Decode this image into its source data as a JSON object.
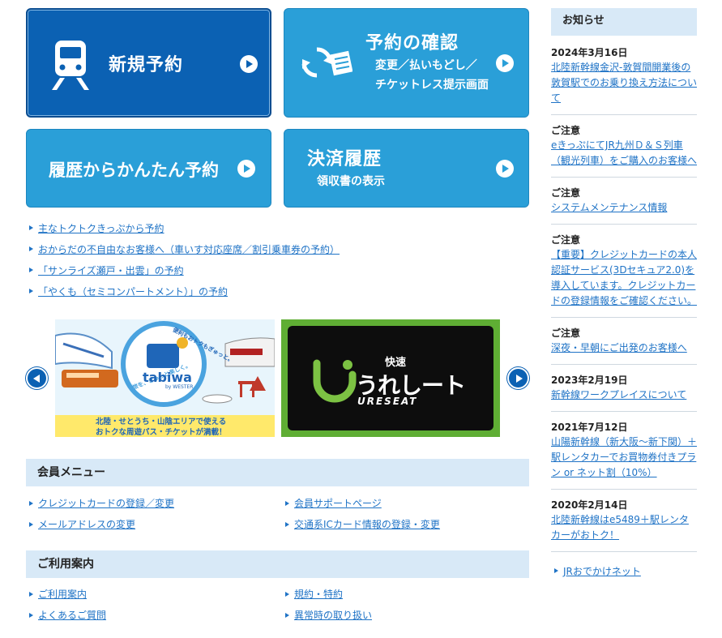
{
  "tiles": {
    "new_reservation": "新規予約",
    "check": {
      "title": "予約の確認",
      "line1": "変更／払いもどし／",
      "line2": "チケットレス提示画面"
    },
    "history_easy": "履歴からかんたん予約",
    "payment": {
      "title": "決済履歴",
      "sub": "領収書の表示"
    }
  },
  "quick_links": [
    "主なトクトクきっぷから予約",
    "おからだの不自由なお客様へ（車いす対応座席／割引乗車券の予約）",
    "「サンライズ瀬戸・出雲」の予約",
    "「やくも（セミコンパートメント）」の予約"
  ],
  "banners": {
    "tabiwa": {
      "logo": "tabiwa",
      "byline": "by WESTER",
      "ring_top": "便利もおトクもぎゅっと。",
      "ring_bottom": "旅を、ぎゅっと楽しく。",
      "caption1": "北陸・せとうち・山陰エリアで使える",
      "caption2": "おトクな周遊パス・チケットが満載！"
    },
    "ureseat": {
      "kaisoku": "快速",
      "name": "うれしート",
      "romaji": "URESEAT"
    }
  },
  "member_menu": {
    "title": "会員メニュー",
    "items": [
      "クレジットカードの登録／変更",
      "会員サポートページ",
      "メールアドレスの変更",
      "交通系ICカード情報の登録・変更"
    ]
  },
  "guide": {
    "title": "ご利用案内",
    "items": [
      "ご利用案内",
      "規約・特約",
      "よくあるご質問",
      "異常時の取り扱い"
    ]
  },
  "notices": {
    "title": "お知らせ",
    "items": [
      {
        "date": "2024年3月16日",
        "text": "北陸新幹線金沢-敦賀間開業後の敦賀駅でのお乗り換え方法について"
      },
      {
        "date": "ご注意",
        "text": "eきっぷにてJR九州Ｄ＆Ｓ列車（観光列車）をご購入のお客様へ"
      },
      {
        "date": "ご注意",
        "text": "システムメンテナンス情報"
      },
      {
        "date": "ご注意",
        "text": "【重要】クレジットカードの本人認証サービス(3Dセキュア2.0)を導入しています。クレジットカードの登録情報をご確認ください。"
      },
      {
        "date": "ご注意",
        "text": "深夜・早朝にご出発のお客様へ"
      },
      {
        "date": "2023年2月19日",
        "text": "新幹線ワークプレイスについて"
      },
      {
        "date": "2021年7月12日",
        "text": "山陽新幹線（新大阪〜新下関）＋駅レンタカーでお買物券付きプラン or ネット割（10%）"
      },
      {
        "date": "2020年2月14日",
        "text": "北陸新幹線はe5489＋駅レンタカーがおトク！"
      }
    ],
    "footer_link": "JRおでかけネット"
  },
  "colors": {
    "primary": "#0b61b3",
    "tile": "#2a9fd8",
    "link": "#1f73c6",
    "section_bg": "#d8e9f7"
  }
}
